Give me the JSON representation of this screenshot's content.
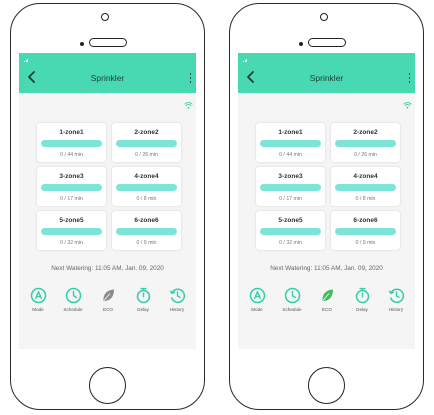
{
  "phones": [
    {
      "app_title": "Sprinkler",
      "zones": [
        {
          "name": "1-zone1",
          "time": "0 / 44 min"
        },
        {
          "name": "2-zone2",
          "time": "0 / 26 min"
        },
        {
          "name": "3-zone3",
          "time": "0 / 17 min"
        },
        {
          "name": "4-zone4",
          "time": "0 / 8 min"
        },
        {
          "name": "5-zone5",
          "time": "0 / 32 min"
        },
        {
          "name": "6-zone6",
          "time": "0 / 9 min"
        }
      ],
      "next_watering": "Next Watering: 11:05 AM, Jan. 09, 2020",
      "actions": [
        {
          "label": "Mode",
          "icon": "mode-icon"
        },
        {
          "label": "Schedule",
          "icon": "clock-icon"
        },
        {
          "label": "ECO",
          "icon": "leaf-icon"
        },
        {
          "label": "Delay",
          "icon": "timer-icon"
        },
        {
          "label": "History",
          "icon": "history-icon"
        }
      ],
      "eco_active": false
    },
    {
      "app_title": "Sprinkler",
      "zones": [
        {
          "name": "1-zone1",
          "time": "0 / 44 min"
        },
        {
          "name": "2-zone2",
          "time": "0 / 26 min"
        },
        {
          "name": "3-zone3",
          "time": "0 / 17 min"
        },
        {
          "name": "4-zone4",
          "time": "0 / 8 min"
        },
        {
          "name": "5-zone5",
          "time": "0 / 32 min"
        },
        {
          "name": "6-zone6",
          "time": "0 / 9 min"
        }
      ],
      "next_watering": "Next Watering: 11:05 AM, Jan. 09, 2020",
      "actions": [
        {
          "label": "Mode",
          "icon": "mode-icon"
        },
        {
          "label": "Schedule",
          "icon": "clock-icon"
        },
        {
          "label": "ECO",
          "icon": "leaf-icon"
        },
        {
          "label": "Delay",
          "icon": "timer-icon"
        },
        {
          "label": "History",
          "icon": "history-icon"
        }
      ],
      "eco_active": true
    }
  ],
  "colors": {
    "header": "#48d9b2",
    "zone_bar": "#7ce5d7",
    "accent": "#2fd0a8",
    "eco_off": "#8a8a8a",
    "eco_on": "#3fbf5a"
  }
}
